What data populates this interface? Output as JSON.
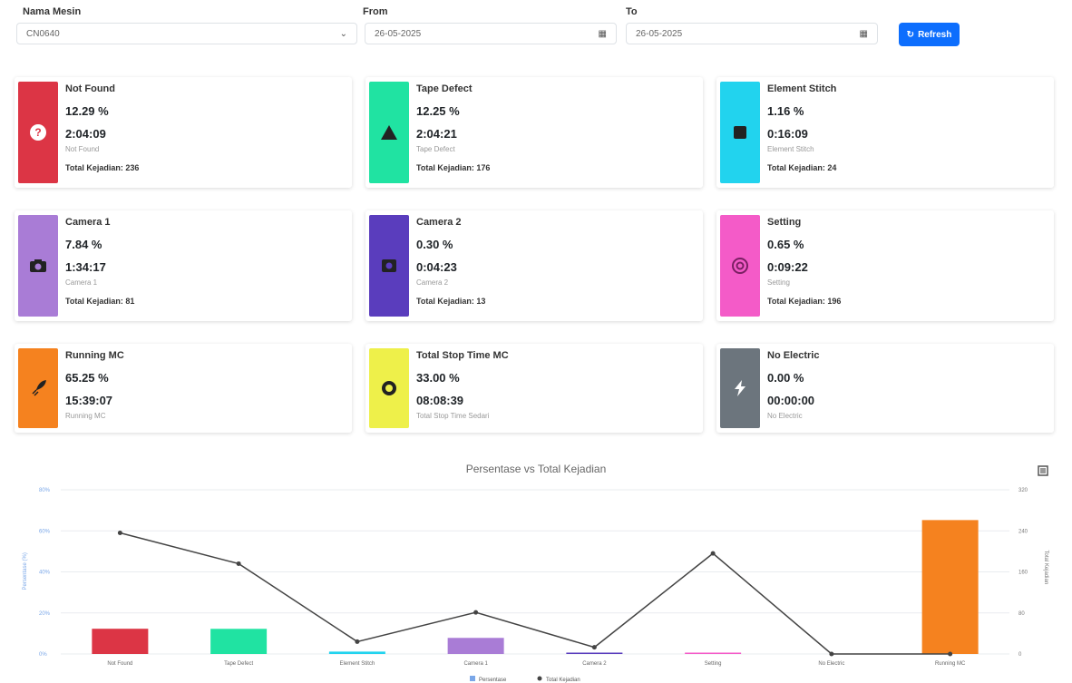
{
  "filters": {
    "name_label": "Nama Mesin",
    "name_value": "CN0640",
    "from_label": "From",
    "from_value": "26-05-2025",
    "to_label": "To",
    "to_value": "26-05-2025",
    "refresh_label": "Refresh"
  },
  "cards": [
    {
      "title": "Not Found",
      "percent": "12.29 %",
      "time": "2:04:09",
      "subtitle": "Not Found",
      "total": "Total Kejadian: 236",
      "color": "#dc3545",
      "icon": "question-circle"
    },
    {
      "title": "Tape Defect",
      "percent": "12.25 %",
      "time": "2:04:21",
      "subtitle": "Tape Defect",
      "total": "Total Kejadian: 176",
      "color": "#20e3a2",
      "icon": "warning-triangle"
    },
    {
      "title": "Element Stitch",
      "percent": "1.16 %",
      "time": "0:16:09",
      "subtitle": "Element Stitch",
      "total": "Total Kejadian: 24",
      "color": "#22d3ee",
      "icon": "square-stop"
    },
    {
      "title": "Camera 1",
      "percent": "7.84 %",
      "time": "1:34:17",
      "subtitle": "Camera 1",
      "total": "Total Kejadian: 81",
      "color": "#a97cd6",
      "icon": "camera"
    },
    {
      "title": "Camera 2",
      "percent": "0.30 %",
      "time": "0:04:23",
      "subtitle": "Camera 2",
      "total": "Total Kejadian: 13",
      "color": "#5a3dbd",
      "icon": "camera-box"
    },
    {
      "title": "Setting",
      "percent": "0.65 %",
      "time": "0:09:22",
      "subtitle": "Setting",
      "total": "Total Kejadian: 196",
      "color": "#f45bc8",
      "icon": "gear-circle"
    },
    {
      "title": "Running MC",
      "percent": "65.25 %",
      "time": "15:39:07",
      "subtitle": "Running MC",
      "total": "",
      "color": "#f5821f",
      "icon": "rocket"
    },
    {
      "title": "Total Stop Time MC",
      "percent": "33.00 %",
      "time": "08:08:39",
      "subtitle": "Total Stop Time Sedari",
      "total": "",
      "color": "#eef04a",
      "icon": "ring"
    },
    {
      "title": "No Electric",
      "percent": "0.00 %",
      "time": "00:00:00",
      "subtitle": "No Electric",
      "total": "",
      "color": "#6c757d",
      "icon": "lightning"
    }
  ],
  "chart_data": {
    "type": "bar",
    "title": "Persentase vs Total Kejadian",
    "categories": [
      "Not Found",
      "Tape Defect",
      "Element Stitch",
      "Camera 1",
      "Camera 2",
      "Setting",
      "No Electric",
      "Running MC"
    ],
    "series": [
      {
        "name": "Persentase",
        "type": "bar",
        "axis": "left",
        "values": [
          12.29,
          12.25,
          1.16,
          7.84,
          0.3,
          0.65,
          0.0,
          65.25
        ],
        "colors": [
          "#dc3545",
          "#20e3a2",
          "#22d3ee",
          "#a97cd6",
          "#5a3dbd",
          "#f45bc8",
          "#6c757d",
          "#f5821f"
        ]
      },
      {
        "name": "Total Kejadian",
        "type": "line",
        "axis": "right",
        "values": [
          236,
          176,
          24,
          81,
          13,
          196,
          0,
          0
        ],
        "color": "#444444"
      }
    ],
    "ylim_left": [
      0,
      80
    ],
    "yticks_left": [
      "0%",
      "20%",
      "40%",
      "60%",
      "80%"
    ],
    "ylabel_left": "Persentase (%)",
    "ylim_right": [
      0,
      320
    ],
    "yticks_right": [
      "0",
      "80",
      "160",
      "240",
      "320"
    ],
    "ylabel_right": "Total Kejadian",
    "grid": true,
    "legend": "bottom"
  }
}
